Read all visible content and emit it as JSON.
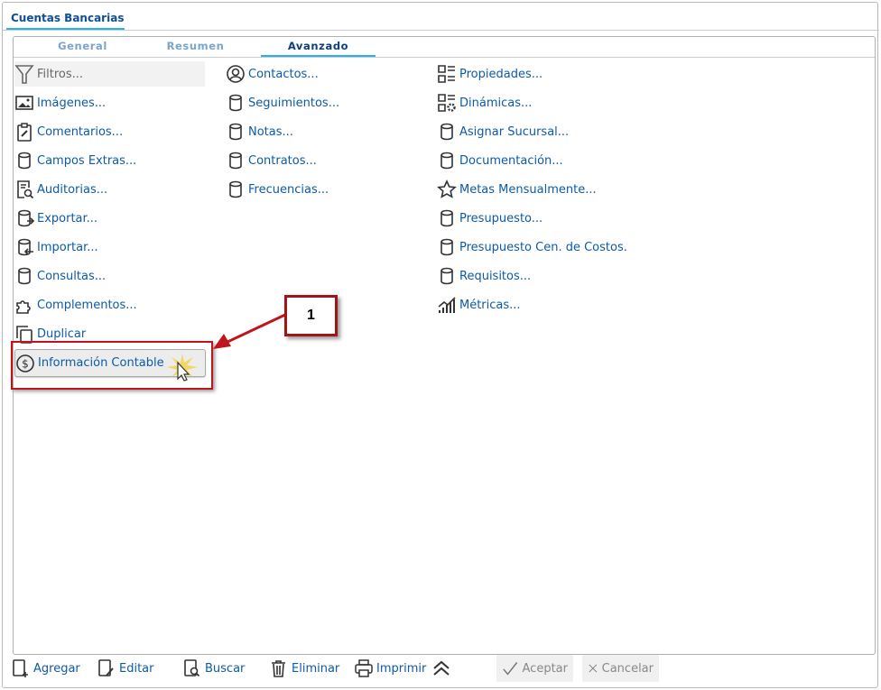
{
  "window": {
    "title": "Cuentas Bancarias"
  },
  "tabs": [
    {
      "label": "General",
      "active": false
    },
    {
      "label": "Resumen",
      "active": false
    },
    {
      "label": "Avanzado",
      "active": true
    }
  ],
  "columns": [
    [
      {
        "label": "Filtros...",
        "icon": "filter-icon"
      },
      {
        "label": "Imágenes...",
        "icon": "image-icon"
      },
      {
        "label": "Comentarios...",
        "icon": "clipboard-edit-icon"
      },
      {
        "label": "Campos Extras...",
        "icon": "database-icon"
      },
      {
        "label": "Auditorias...",
        "icon": "document-search-icon"
      },
      {
        "label": "Exportar...",
        "icon": "database-export-icon"
      },
      {
        "label": "Importar...",
        "icon": "database-import-icon"
      },
      {
        "label": "Consultas...",
        "icon": "database-icon"
      },
      {
        "label": "Complementos...",
        "icon": "puzzle-icon"
      },
      {
        "label": "Duplicar",
        "icon": "copy-icon"
      },
      {
        "label": "Información Contable",
        "icon": "dollar-circle-icon"
      }
    ],
    [
      {
        "label": "Contactos...",
        "icon": "user-circle-icon"
      },
      {
        "label": "Seguimientos...",
        "icon": "database-icon"
      },
      {
        "label": "Notas...",
        "icon": "database-icon"
      },
      {
        "label": "Contratos...",
        "icon": "database-icon"
      },
      {
        "label": "Frecuencias...",
        "icon": "database-icon"
      }
    ],
    [
      {
        "label": "Propiedades...",
        "icon": "properties-icon"
      },
      {
        "label": "Dinámicas...",
        "icon": "dynamics-gear-icon"
      },
      {
        "label": "Asignar Sucursal...",
        "icon": "database-icon"
      },
      {
        "label": "Documentación...",
        "icon": "database-icon"
      },
      {
        "label": "Metas Mensualmente...",
        "icon": "star-icon"
      },
      {
        "label": "Presupuesto...",
        "icon": "database-icon"
      },
      {
        "label": "Presupuesto Cen. de Costos.",
        "icon": "database-icon"
      },
      {
        "label": "Requisitos...",
        "icon": "database-icon"
      },
      {
        "label": "Métricas...",
        "icon": "chart-icon"
      }
    ]
  ],
  "annotation": {
    "number": "1"
  },
  "toolbar": {
    "add": "Agregar",
    "edit": "Editar",
    "search": "Buscar",
    "delete": "Eliminar",
    "print": "Imprimir",
    "accept": "Aceptar",
    "cancel": "Cancelar"
  },
  "colors": {
    "link": "#0d5aa6",
    "accent": "#2ab0ef",
    "annotation": "#c0141c"
  }
}
